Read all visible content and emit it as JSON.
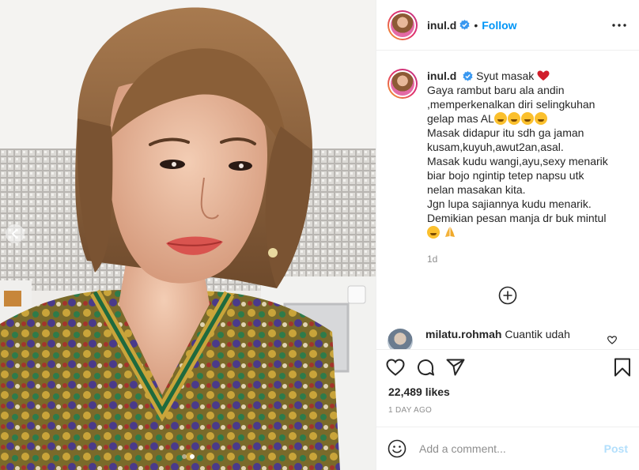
{
  "post": {
    "username": "inul.d",
    "follow_label": "Follow",
    "separator": "•",
    "caption": {
      "line1_text": "Syut masak",
      "line2": "Gaya rambut baru ala andin",
      "line3": ",memperkenalkan diri selingkuhan",
      "line4_text": "gelap mas AL",
      "line5": "Masak didapur itu sdh ga jaman",
      "line6": "kusam,kuyuh,awut2an,asal.",
      "line7": "Masak kudu wangi,ayu,sexy menarik",
      "line8": "biar bojo ngintip tetep napsu utk",
      "line9": "nelan masakan kita.",
      "line10": "Jgn lupa sajiannya kudu menarik.",
      "line11": "Demikian pesan manja dr buk mintul"
    },
    "caption_time": "1d",
    "comment": {
      "username": "milatu.rohmah",
      "text": "Cuantik udah"
    },
    "likes": "22,489 likes",
    "date": "1 DAY AGO",
    "add_comment_placeholder": "Add a comment...",
    "post_label": "Post"
  },
  "icons": {
    "verified": "verified-badge-icon",
    "more": "more-options-icon",
    "heart": "heart-icon",
    "comment": "comment-icon",
    "share": "share-icon",
    "save": "bookmark-icon",
    "emoji": "emoji-icon",
    "load_more": "plus-circle-icon",
    "prev": "chevron-left-icon"
  },
  "colors": {
    "accent": "#0095f6",
    "post_disabled": "#b2dffc",
    "secondary_text": "#8e8e8e",
    "heart_red": "#e0245e"
  },
  "carousel": {
    "total": 2,
    "active_index": 1
  }
}
